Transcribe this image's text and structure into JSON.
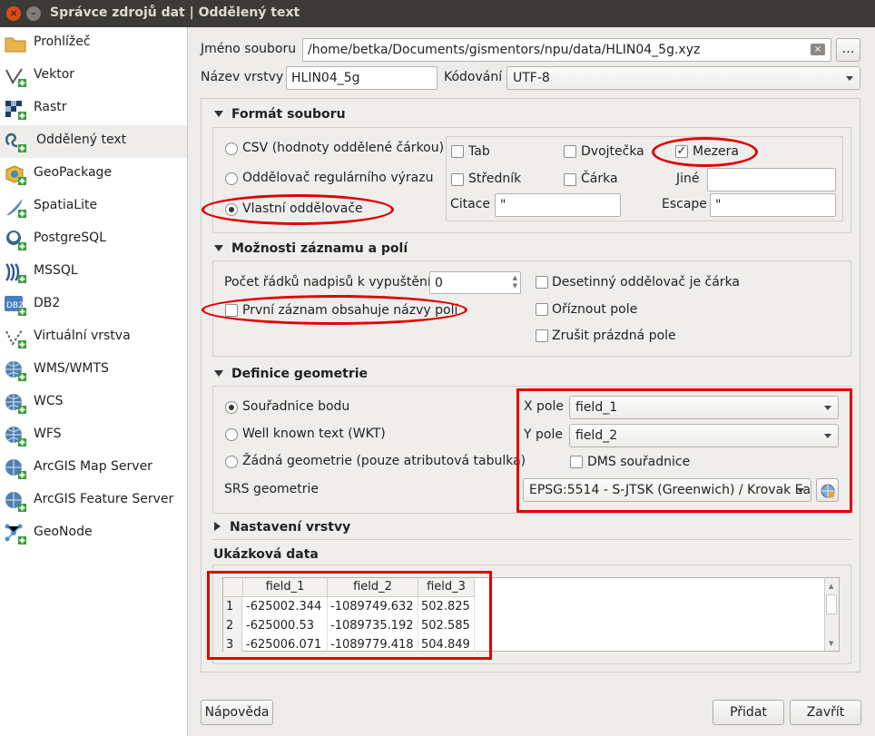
{
  "window": {
    "title": "Správce zdrojů dat | Oddělený text"
  },
  "sidebar": {
    "items": [
      {
        "label": "Prohlížeč",
        "icon": "folder-icon"
      },
      {
        "label": "Vektor",
        "icon": "vector-icon"
      },
      {
        "label": "Rastr",
        "icon": "raster-icon"
      },
      {
        "label": "Oddělený text",
        "icon": "delimited-text-icon",
        "active": true
      },
      {
        "label": "GeoPackage",
        "icon": "geopackage-icon"
      },
      {
        "label": "SpatiaLite",
        "icon": "spatialite-icon"
      },
      {
        "label": "PostgreSQL",
        "icon": "postgresql-icon"
      },
      {
        "label": "MSSQL",
        "icon": "mssql-icon"
      },
      {
        "label": "DB2",
        "icon": "db2-icon"
      },
      {
        "label": "Virtuální vrstva",
        "icon": "virtual-layer-icon"
      },
      {
        "label": "WMS/WMTS",
        "icon": "wms-icon"
      },
      {
        "label": "WCS",
        "icon": "wcs-icon"
      },
      {
        "label": "WFS",
        "icon": "wfs-icon"
      },
      {
        "label": "ArcGIS Map Server",
        "icon": "arcgis-map-icon"
      },
      {
        "label": "ArcGIS Feature Server",
        "icon": "arcgis-feature-icon"
      },
      {
        "label": "GeoNode",
        "icon": "geonode-icon"
      }
    ]
  },
  "file": {
    "label": "Jméno souboru",
    "value": "/home/betka/Documents/gismentors/npu/data/HLIN04_5g.xyz",
    "browse": "…"
  },
  "layer": {
    "label": "Název vrstvy",
    "value": "HLIN04_5g",
    "encoding_label": "Kódování",
    "encoding": "UTF-8"
  },
  "format": {
    "title": "Formát souboru",
    "csv": "CSV (hodnoty oddělené čárkou)",
    "regex": "Oddělovač regulárního výrazu",
    "custom": "Vlastní oddělovače",
    "tab": "Tab",
    "colon": "Dvojtečka",
    "space": "Mezera",
    "semicolon": "Středník",
    "comma": "Čárka",
    "other": "Jiné",
    "quote_label": "Citace",
    "quote_value": "\"",
    "escape_label": "Escape",
    "escape_value": "\""
  },
  "records": {
    "title": "Možnosti záznamu a polí",
    "skip_label": "Počet řádků nadpisů k vypuštění",
    "skip_value": "0",
    "first_record": "První záznam obsahuje názvy polí",
    "decimal_comma": "Desetinný oddělovač je čárka",
    "trim": "Oříznout pole",
    "discard_empty": "Zrušit prázdná pole"
  },
  "geometry": {
    "title": "Definice geometrie",
    "point": "Souřadnice bodu",
    "wkt": "Well known text (WKT)",
    "none": "Žádná geometrie (pouze atributová tabulka)",
    "srs_label": "SRS geometrie",
    "x_label": "X pole",
    "x_value": "field_1",
    "y_label": "Y pole",
    "y_value": "field_2",
    "dms": "DMS souřadnice",
    "srs_value": "EPSG:5514 - S-JTSK (Greenwich) / Krovak Ea"
  },
  "layer_settings": {
    "title": "Nastavení vrstvy"
  },
  "sample": {
    "title": "Ukázková data",
    "columns": [
      "field_1",
      "field_2",
      "field_3"
    ],
    "rows": [
      [
        "1",
        "-625002.344",
        "-1089749.632",
        "502.825"
      ],
      [
        "2",
        "-625000.53",
        "-1089735.192",
        "502.585"
      ],
      [
        "3",
        "-625006.071",
        "-1089779.418",
        "504.849"
      ]
    ]
  },
  "buttons": {
    "help": "Nápověda",
    "add": "Přidat",
    "close": "Zavřít"
  },
  "colors": {
    "annotation": "#e00000",
    "titlebar": "#3b3a36",
    "close_button": "#df4a16"
  }
}
